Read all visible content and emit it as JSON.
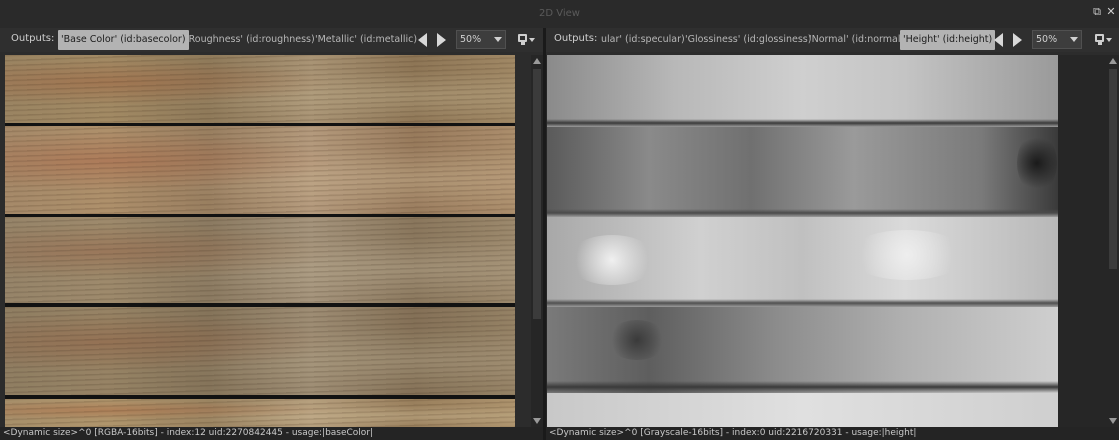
{
  "window": {
    "title": "2D View"
  },
  "left_panel": {
    "outputs_label": "Outputs:",
    "tabs": [
      {
        "label": "'Base Color' (id:basecolor)",
        "active": true
      },
      {
        "label": "'Roughness' (id:roughness)",
        "active": false
      },
      {
        "label": "'Metallic' (id:metallic)",
        "active": false
      }
    ],
    "zoom": "50%",
    "status": "<Dynamic size>^0 [RGBA-16bits] - index:12 uid:2270842445 - usage:|baseColor|"
  },
  "right_panel": {
    "outputs_label": "Outputs:",
    "tabs": [
      {
        "label": "ular' (id:specular)",
        "active": false
      },
      {
        "label": "'Glossiness' (id:glossiness)",
        "active": false
      },
      {
        "label": "'Normal' (id:normal)",
        "active": false
      },
      {
        "label": "'Height' (id:height)",
        "active": true
      }
    ],
    "zoom": "50%",
    "status": "<Dynamic size>^0 [Grayscale-16bits] - index:0 uid:2216720331 - usage:|height|"
  },
  "icons": {
    "prev": "arrow-left-icon",
    "next": "arrow-right-icon",
    "view_mode": "monitor-icon",
    "restore": "restore-window-icon",
    "close": "close-icon"
  }
}
